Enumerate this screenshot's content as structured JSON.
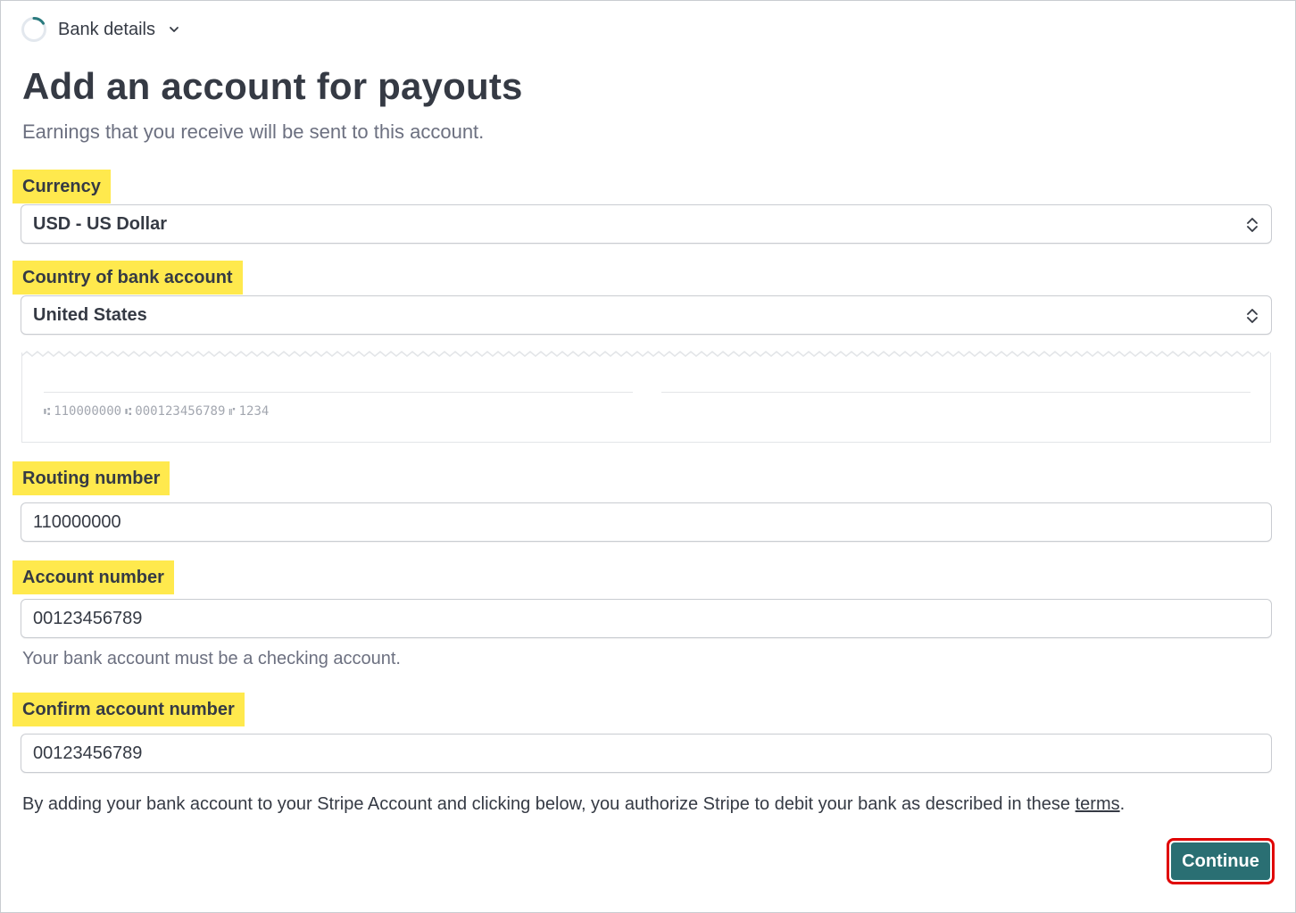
{
  "step": {
    "label": "Bank details",
    "ring_color": "#2a7a7e"
  },
  "page": {
    "title": "Add an account for payouts",
    "subtitle": "Earnings that you receive will be sent to this account."
  },
  "currency": {
    "label": "Currency",
    "value": "USD - US Dollar"
  },
  "country": {
    "label": "Country of bank account",
    "value": "United States"
  },
  "check": {
    "routing": "110000000",
    "account": "000123456789",
    "check_no": "1234"
  },
  "routing": {
    "label": "Routing number",
    "value": "110000000"
  },
  "account": {
    "label": "Account number",
    "value": "00123456789",
    "helper": "Your bank account must be a checking account."
  },
  "confirm": {
    "label": "Confirm account number",
    "value": "00123456789"
  },
  "legal": {
    "text": "By adding your bank account to your Stripe Account and clicking below, you authorize Stripe to debit your bank as described in these ",
    "link": "terms",
    "end": "."
  },
  "continue_label": "Continue",
  "colors": {
    "highlight": "#ffe94d",
    "button": "#2a6f73",
    "button_outline": "#e00000"
  }
}
